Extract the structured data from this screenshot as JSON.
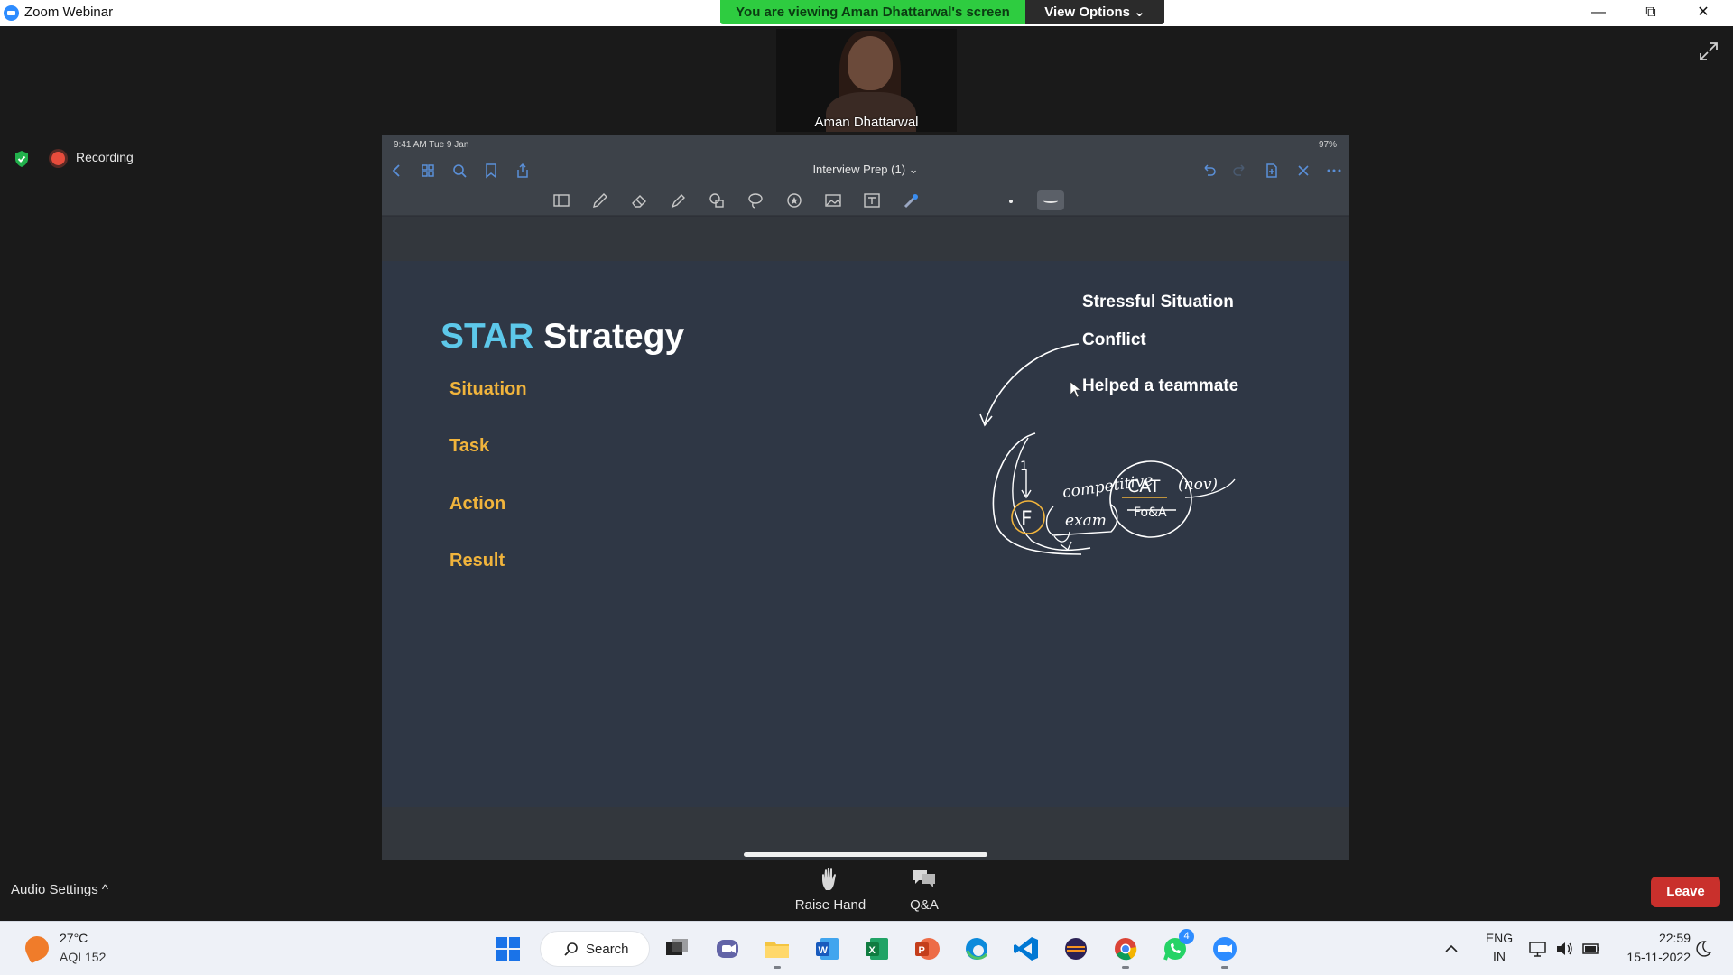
{
  "window": {
    "title": "Zoom Webinar",
    "share_banner": "You are viewing Aman Dhattarwal's screen",
    "view_options": "View Options ⌄",
    "controls": {
      "minimize": "—",
      "restore": "⧉",
      "close": "✕"
    }
  },
  "video": {
    "participant_name": "Aman Dhattarwal"
  },
  "recording": {
    "label": "Recording"
  },
  "ipad": {
    "status_time": "9:41 AM  Tue 9 Jan",
    "status_right": "97%",
    "doc_title": "Interview Prep (1) ⌄"
  },
  "slide": {
    "title_accent": "STAR",
    "title_rest": " Strategy",
    "star_items": [
      "Situation",
      "Task",
      "Action",
      "Result"
    ],
    "examples": [
      "Stressful Situation",
      "Conflict",
      "Helped a teammate"
    ],
    "handwriting": {
      "competitive": "competitive",
      "exam": "exam",
      "letter_f": "F",
      "cat": "CAT",
      "nov": "(nov)",
      "crossed": "Fo&A",
      "one": "1"
    }
  },
  "controls": {
    "audio_settings": "Audio Settings ^",
    "raise_hand": "Raise Hand",
    "qa": "Q&A",
    "leave": "Leave"
  },
  "taskbar": {
    "temperature": "27°C",
    "aqi": "AQI 152",
    "search": "Search",
    "whatsapp_badge": "4",
    "lang_top": "ENG",
    "lang_bottom": "IN",
    "time": "22:59",
    "date": "15-11-2022"
  },
  "colors": {
    "share_banner": "#2ecc40",
    "slide_background": "#2f3745",
    "title_accent": "#5dc8ea",
    "star_items": "#f1b43c",
    "leave": "#c9302c"
  }
}
